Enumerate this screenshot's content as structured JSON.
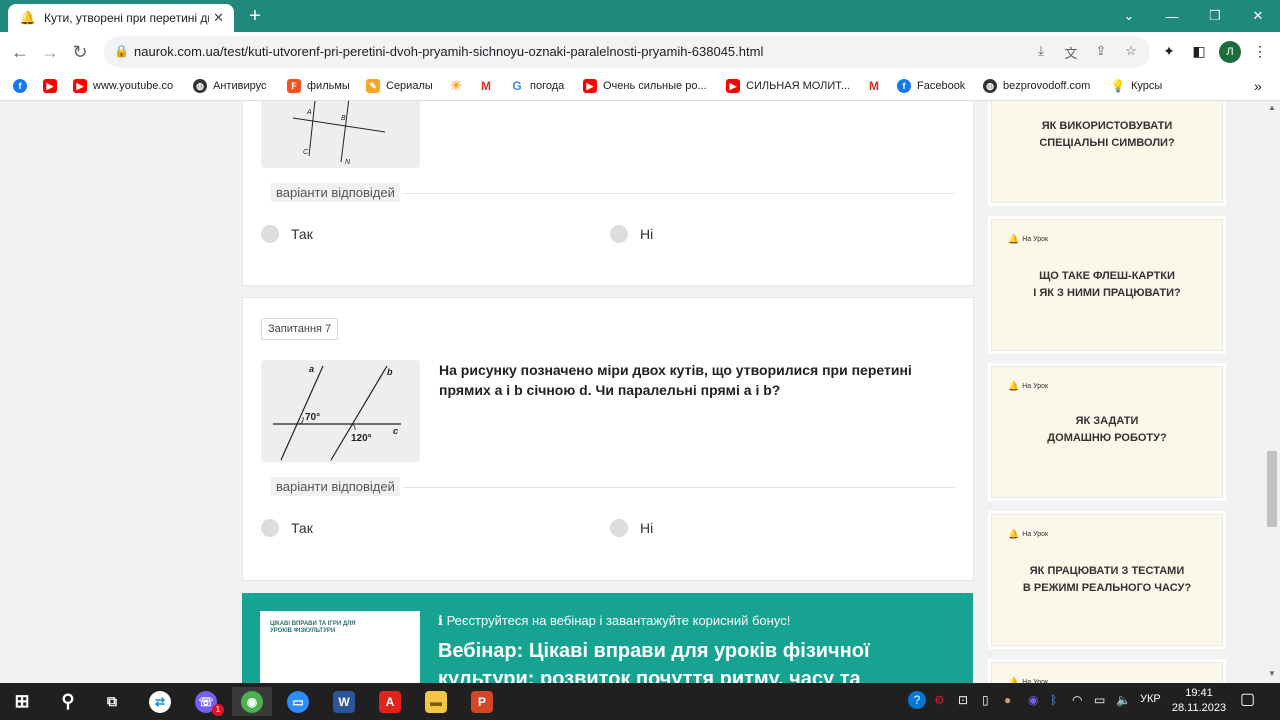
{
  "browser": {
    "tab_title": "Кути, утворені при перетині дв",
    "url": "naurok.com.ua/test/kuti-utvorenf-pri-peretini-dvoh-pryamih-sichnoyu-oznaki-paralelnosti-pryamih-638045.html",
    "avatar_letter": "Л",
    "bookmarks": [
      {
        "label": "",
        "icon": "facebook-icon",
        "color": "#1877f2"
      },
      {
        "label": "",
        "icon": "youtube-icon",
        "color": "#ff0000"
      },
      {
        "label": "www.youtube.co",
        "icon": "youtube-icon",
        "color": "#ff0000"
      },
      {
        "label": "Антивирус",
        "icon": "globe-icon",
        "color": "#333333"
      },
      {
        "label": "фильмы",
        "icon": "film-icon",
        "color": "#f4511e"
      },
      {
        "label": "Сериалы",
        "icon": "bookmark-icon",
        "color": "#f9a825"
      },
      {
        "label": "",
        "icon": "sun-icon",
        "color": "#f9a825"
      },
      {
        "label": "",
        "icon": "gmail-icon",
        "color": "#d93025"
      },
      {
        "label": "погода",
        "icon": "google-icon",
        "color": "#4285f4"
      },
      {
        "label": "Очень сильные ро...",
        "icon": "youtube-icon",
        "color": "#ff0000"
      },
      {
        "label": "СИЛЬНАЯ МОЛИТ...",
        "icon": "youtube-icon",
        "color": "#ff0000"
      },
      {
        "label": "",
        "icon": "gmail-icon",
        "color": "#d93025"
      },
      {
        "label": "Facebook",
        "icon": "facebook-icon",
        "color": "#1877f2"
      },
      {
        "label": "bezprovodoff.com",
        "icon": "globe-icon",
        "color": "#333333"
      },
      {
        "label": "Курсы",
        "icon": "bulb-icon",
        "color": "#4285f4"
      }
    ]
  },
  "quiz": {
    "answers_label": "варіанти відповідей",
    "q6": {
      "options": [
        "Так",
        "Ні"
      ]
    },
    "q7": {
      "number_label": "Запитання 7",
      "text": "На рисунку позначено міри двох кутів, що утворилися при перетині прямих а і b січною d. Чи паралельні прямі а і b?",
      "figure": {
        "angle1": "70°",
        "angle2": "120°",
        "label_a": "a",
        "label_b": "b",
        "label_c": "c"
      },
      "options": [
        "Так",
        "Ні"
      ]
    },
    "q6_figure": {
      "label_A": "A",
      "label_B": "B",
      "label_C": "C",
      "label_N": "N"
    }
  },
  "banner": {
    "line1": "Реєструйтеся на вебінар і завантажуйте корисний бонус!",
    "line2": "Вебінар: Цікаві вправи для уроків фізичної культури: розвиток почуття ритму, часу та",
    "thumb_title": "ЦІКАВІ ВПРАВИ ТА ІГРИ ДЛЯ УРОКІВ ФІЗКУЛЬТУРИ"
  },
  "sidebar": {
    "brand": "На Урок",
    "cards": [
      "ЯК ВИКОРИСТОВУВАТИ\nСПЕЦІАЛЬНІ СИМВОЛИ?",
      "ЩО ТАКЕ ФЛЕШ-КАРТКИ\nІ ЯК З НИМИ ПРАЦЮВАТИ?",
      "ЯК ЗАДАТИ\nДОМАШНЮ РОБОТУ?",
      "ЯК ПРАЦЮВАТИ З ТЕСТАМИ\nВ РЕЖИМІ РЕАЛЬНОГО ЧАСУ?"
    ]
  },
  "taskbar": {
    "language": "УКР",
    "time": "19:41",
    "date": "28.11.2023",
    "viber_badge": "1"
  }
}
